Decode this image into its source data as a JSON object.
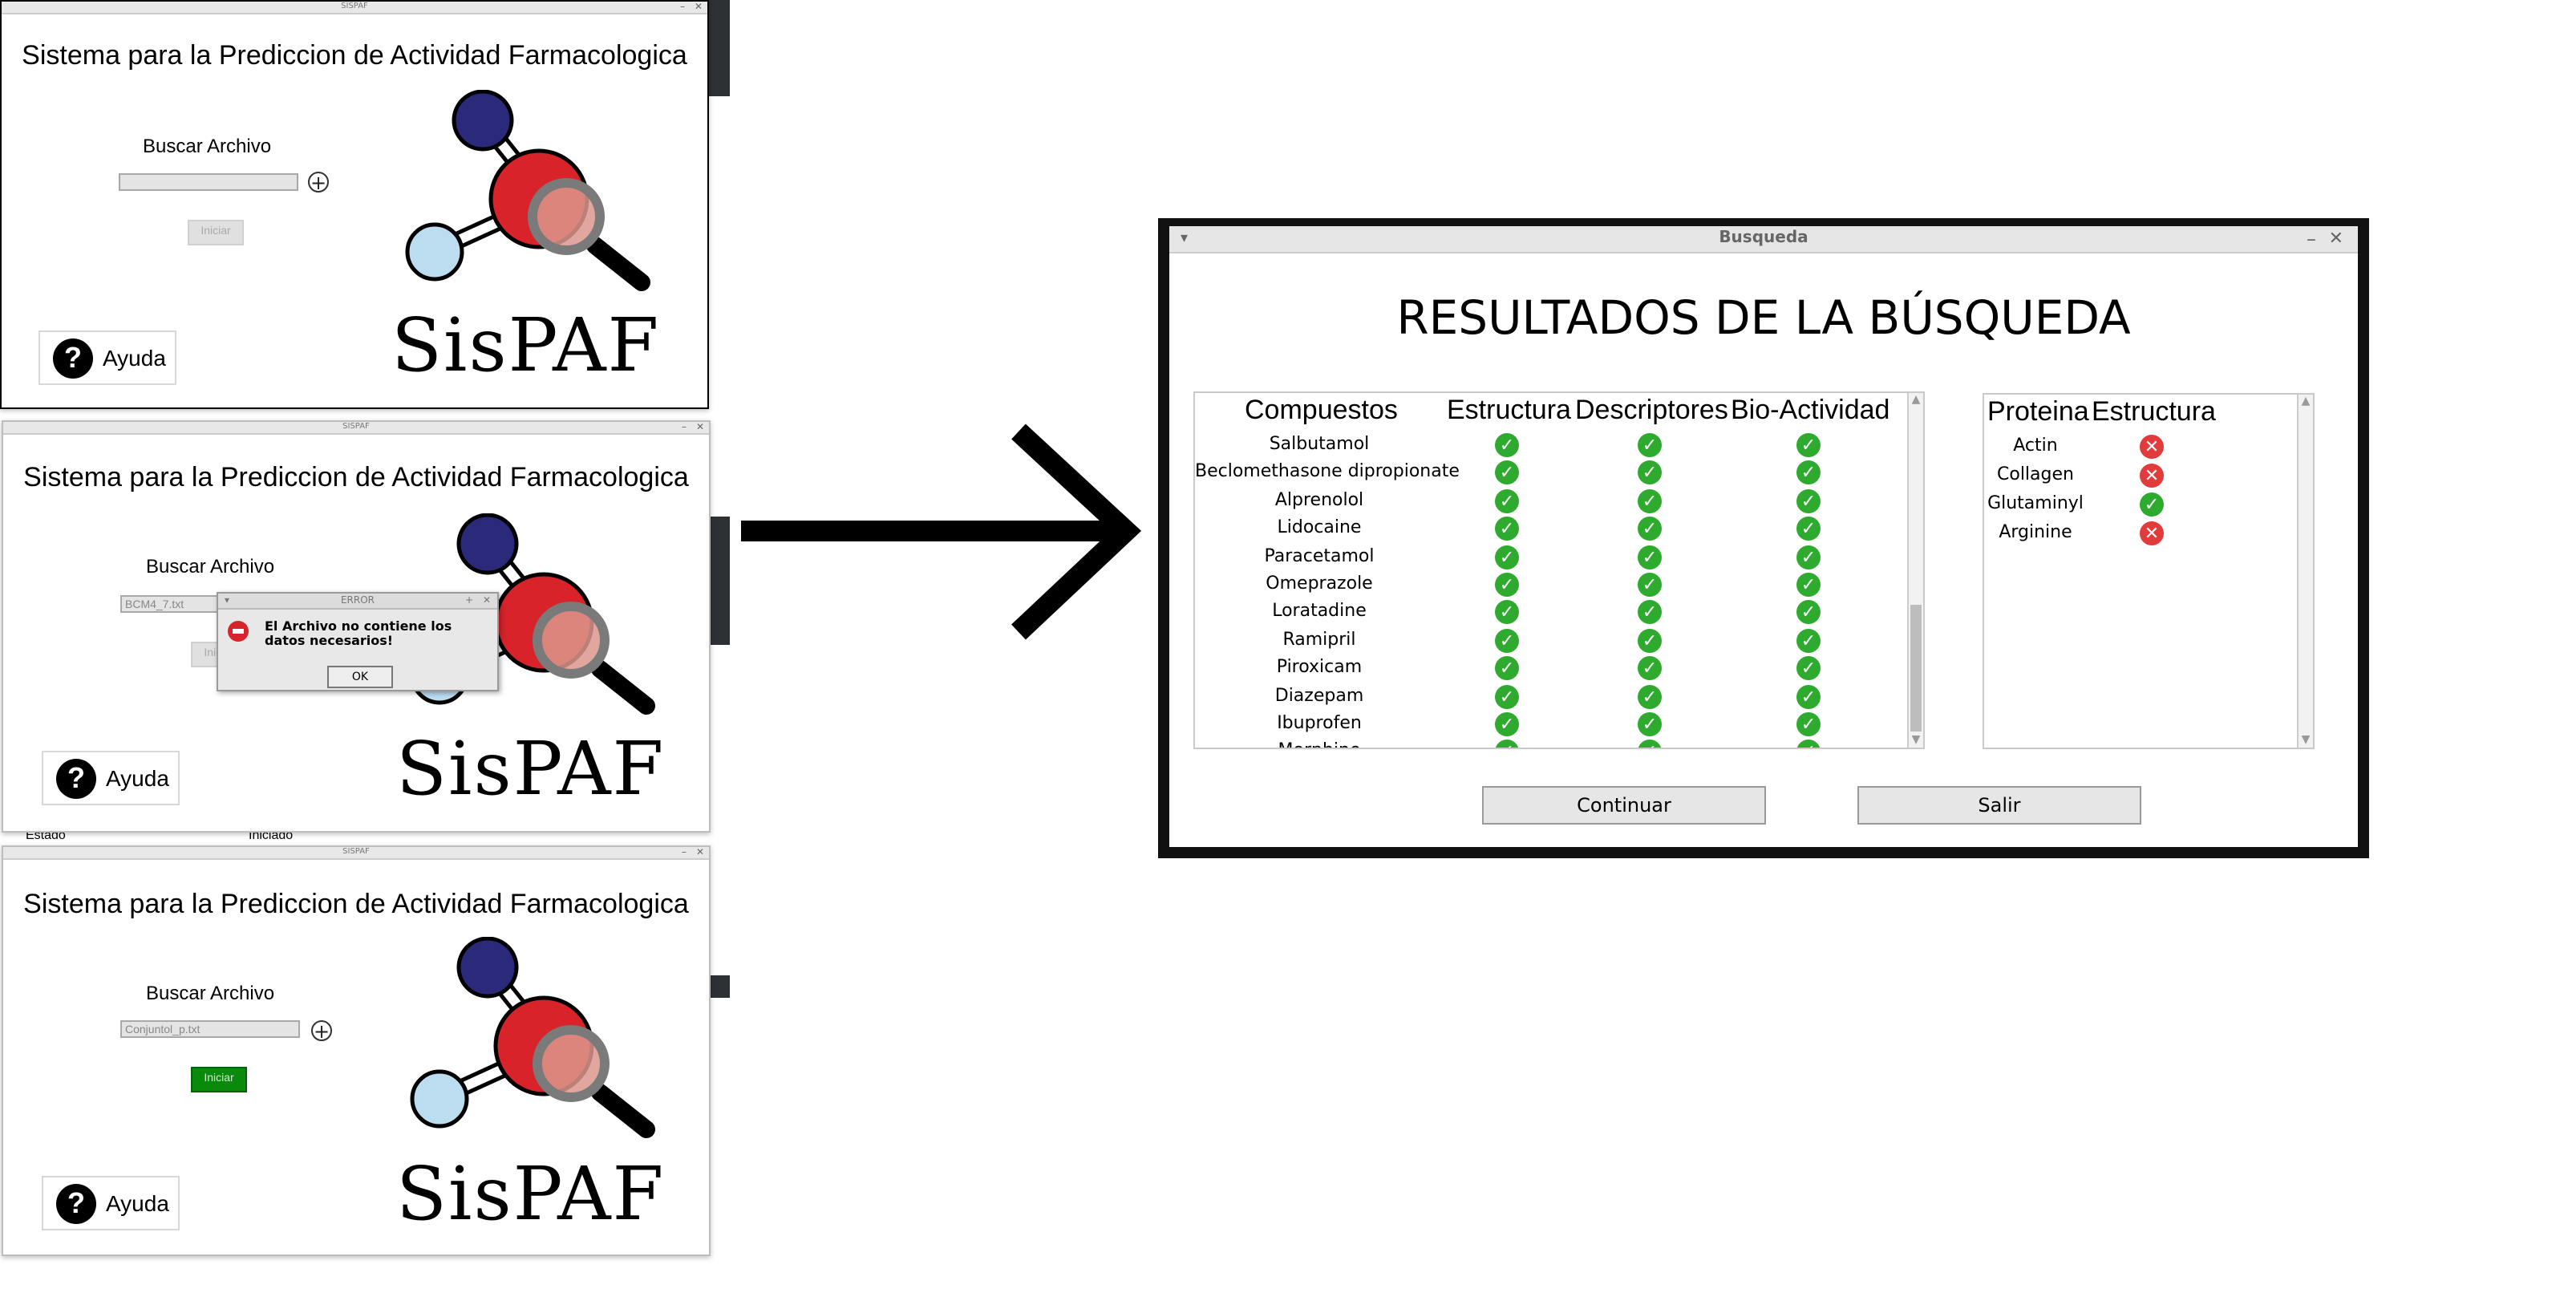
{
  "sispaf_window": {
    "title_bar": "SISPAF",
    "heading": "Sistema para la Prediccion de Actividad Farmacologica",
    "search_label": "Buscar Archivo",
    "start_button": "Iniciar",
    "help_label": "Ayuda",
    "brand": "SisPAF"
  },
  "screens": [
    {
      "file_value": "",
      "start_enabled": false
    },
    {
      "file_value": "BCM4_7.txt",
      "start_enabled": false
    },
    {
      "file_value": "Conjuntol_p.txt",
      "start_enabled": true
    }
  ],
  "error_dialog": {
    "title": "ERROR",
    "message": "El Archivo no contiene los datos necesarios!",
    "ok": "OK"
  },
  "background_fragments": {
    "estado": "Estado",
    "iniciado": "Iniciado"
  },
  "results_window": {
    "title": "Busqueda",
    "heading": "RESULTADOS DE LA BÚSQUEDA",
    "compounds_panel": {
      "headers": [
        "Compuestos",
        "Estructura",
        "Descriptores",
        "Bio-Actividad"
      ],
      "rows": [
        {
          "name": "Salbutamol",
          "estructura": true,
          "descriptores": true,
          "bioactividad": true
        },
        {
          "name": "Beclomethasone dipropionate",
          "estructura": true,
          "descriptores": true,
          "bioactividad": true
        },
        {
          "name": "Alprenolol",
          "estructura": true,
          "descriptores": true,
          "bioactividad": true
        },
        {
          "name": "Lidocaine",
          "estructura": true,
          "descriptores": true,
          "bioactividad": true
        },
        {
          "name": "Paracetamol",
          "estructura": true,
          "descriptores": true,
          "bioactividad": true
        },
        {
          "name": "Omeprazole",
          "estructura": true,
          "descriptores": true,
          "bioactividad": true
        },
        {
          "name": "Loratadine",
          "estructura": true,
          "descriptores": true,
          "bioactividad": true
        },
        {
          "name": "Ramipril",
          "estructura": true,
          "descriptores": true,
          "bioactividad": true
        },
        {
          "name": "Piroxicam",
          "estructura": true,
          "descriptores": true,
          "bioactividad": true
        },
        {
          "name": "Diazepam",
          "estructura": true,
          "descriptores": true,
          "bioactividad": true
        },
        {
          "name": "Ibuprofen",
          "estructura": true,
          "descriptores": true,
          "bioactividad": true
        },
        {
          "name": "Morphine",
          "estructura": true,
          "descriptores": true,
          "bioactividad": true
        }
      ]
    },
    "proteins_panel": {
      "headers": [
        "Proteina",
        "Estructura"
      ],
      "rows": [
        {
          "name": "Actin",
          "estructura": false
        },
        {
          "name": "Collagen",
          "estructura": false
        },
        {
          "name": "Glutaminyl",
          "estructura": true
        },
        {
          "name": "Arginine",
          "estructura": false
        }
      ]
    },
    "buttons": {
      "continue": "Continuar",
      "exit": "Salir"
    }
  },
  "colors": {
    "ok": "#2eaa2e",
    "error": "#e23b3b",
    "start_enabled": "#0a8a0a",
    "oxygen": "#d8232a",
    "nitrogen": "#2b2a7a",
    "hydrogen": "#bcdcef"
  },
  "icons": {
    "ok": "check-circle-icon",
    "error": "x-circle-icon",
    "help": "question-icon",
    "add": "plus-circle-icon",
    "arrow": "chevron-right-icon"
  }
}
